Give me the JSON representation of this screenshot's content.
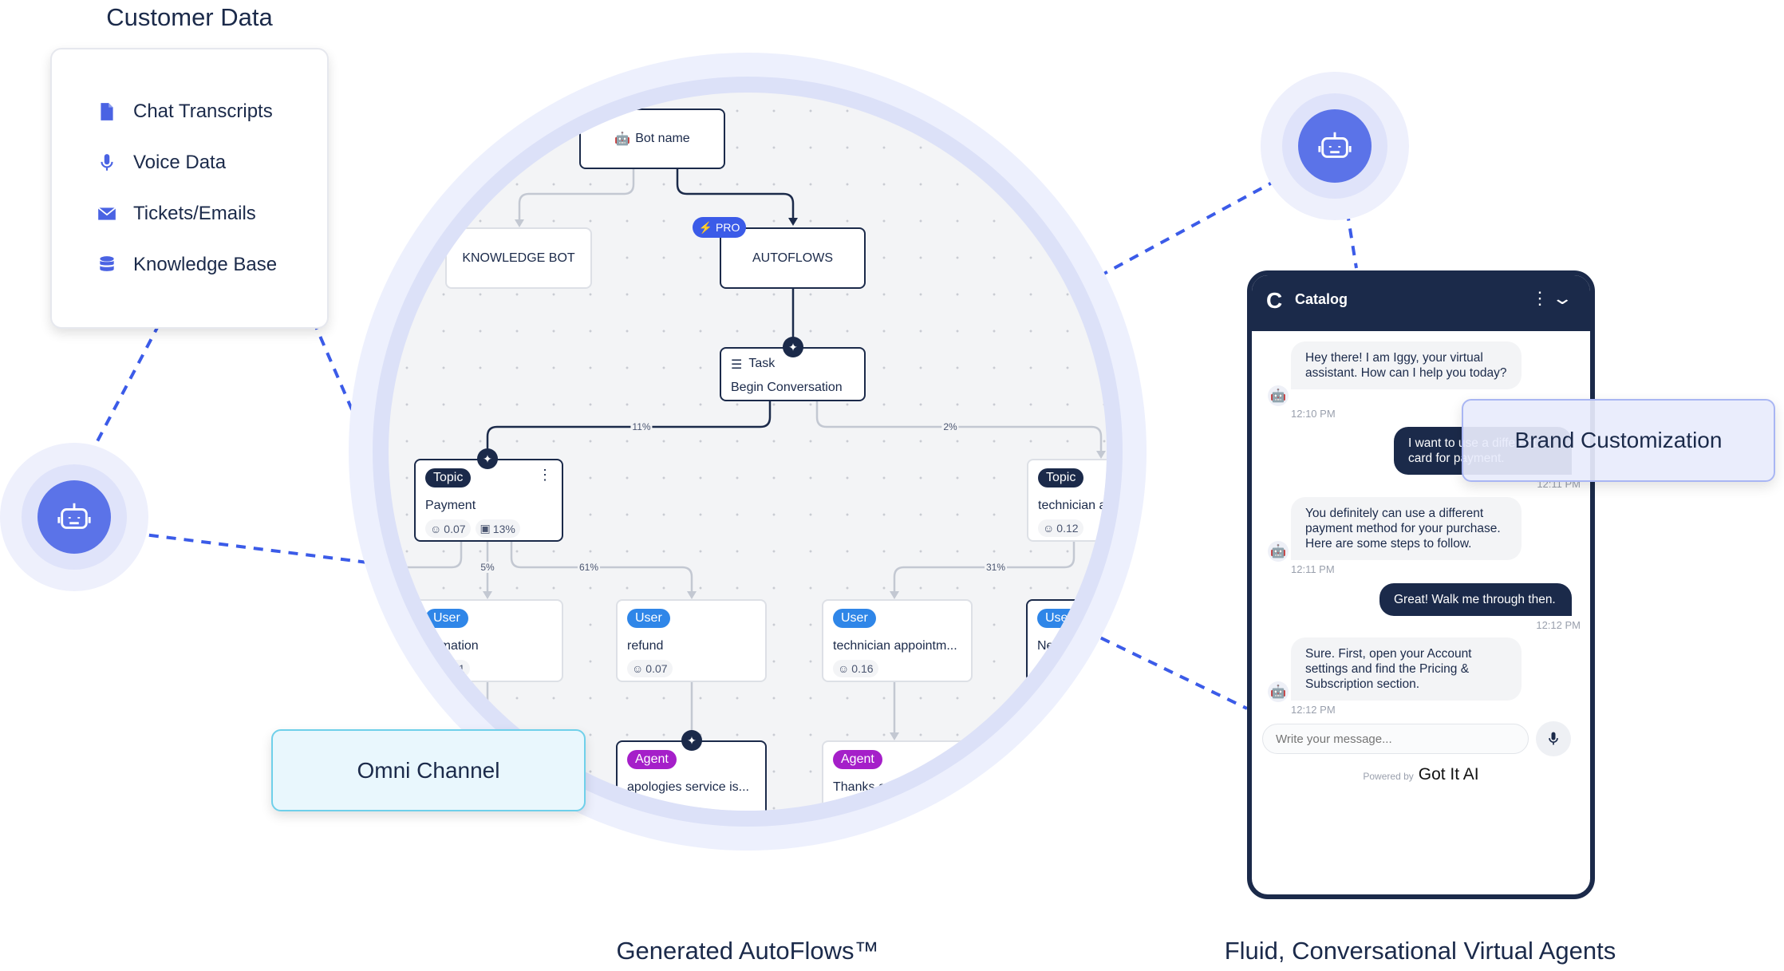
{
  "sections": {
    "customer_data": "Customer Data",
    "autoflows": "Generated AutoFlows™",
    "agents": "Fluid, Conversational Virtual Agents"
  },
  "customer_data": {
    "items": [
      {
        "label": "Chat Transcripts",
        "icon": "document-icon"
      },
      {
        "label": "Voice Data",
        "icon": "microphone-icon"
      },
      {
        "label": "Tickets/Emails",
        "icon": "envelope-icon"
      },
      {
        "label": "Knowledge Base",
        "icon": "database-icon"
      }
    ]
  },
  "callouts": {
    "omni": "Omni Channel",
    "brand": "Brand Customization"
  },
  "colors": {
    "accent": "#5b73e8",
    "navy": "#1b2a4a",
    "user": "#2f86e8",
    "agent": "#a51fc9",
    "pro": "#3b5be8"
  },
  "flow": {
    "bot_name": "Bot name",
    "knowledge_bot": "KNOWLEDGE BOT",
    "autoflows": "AUTOFLOWS",
    "pro": "PRO",
    "task": {
      "tag": "Task",
      "text": "Begin Conversation"
    },
    "edges": {
      "e1": "11%",
      "e2": "2%",
      "e3": "5%",
      "e4": "61%",
      "e5": "31%"
    },
    "topics": [
      {
        "tag": "Topic",
        "text": "Payment",
        "score": "0.07",
        "pct": "13%"
      },
      {
        "tag": "Topic",
        "text": "technician ap",
        "score": "0.12"
      }
    ],
    "users": [
      {
        "tag": "User",
        "text": "formation",
        "score": "0.11"
      },
      {
        "tag": "User",
        "text": "refund",
        "score": "0.07"
      },
      {
        "tag": "User",
        "text": "technician appointm...",
        "score": "0.16"
      },
      {
        "tag": "User",
        "text": "Nee"
      }
    ],
    "agents": [
      {
        "tag": "Agent",
        "text": "apologies service is..."
      },
      {
        "tag": "Agent",
        "text": "Thanks conta"
      }
    ]
  },
  "chat": {
    "title": "Catalog",
    "messages": [
      {
        "from": "bot",
        "text": "Hey there! I am Iggy, your virtual assistant. How can I help you today?",
        "time": "12:10 PM"
      },
      {
        "from": "user",
        "text": "I want to use a different card for payment.",
        "time": "12:11 PM"
      },
      {
        "from": "bot",
        "text": "You definitely can use a different payment method for your purchase. Here are some steps to follow.",
        "time": "12:11 PM"
      },
      {
        "from": "user",
        "text": "Great! Walk me through then.",
        "time": "12:12 PM"
      },
      {
        "from": "bot",
        "text": "Sure. First, open your Account settings and find the Pricing & Subscription section.",
        "time": "12:12 PM"
      }
    ],
    "input_placeholder": "Write your message...",
    "powered_by": "Powered by",
    "brand": "Got It AI"
  }
}
